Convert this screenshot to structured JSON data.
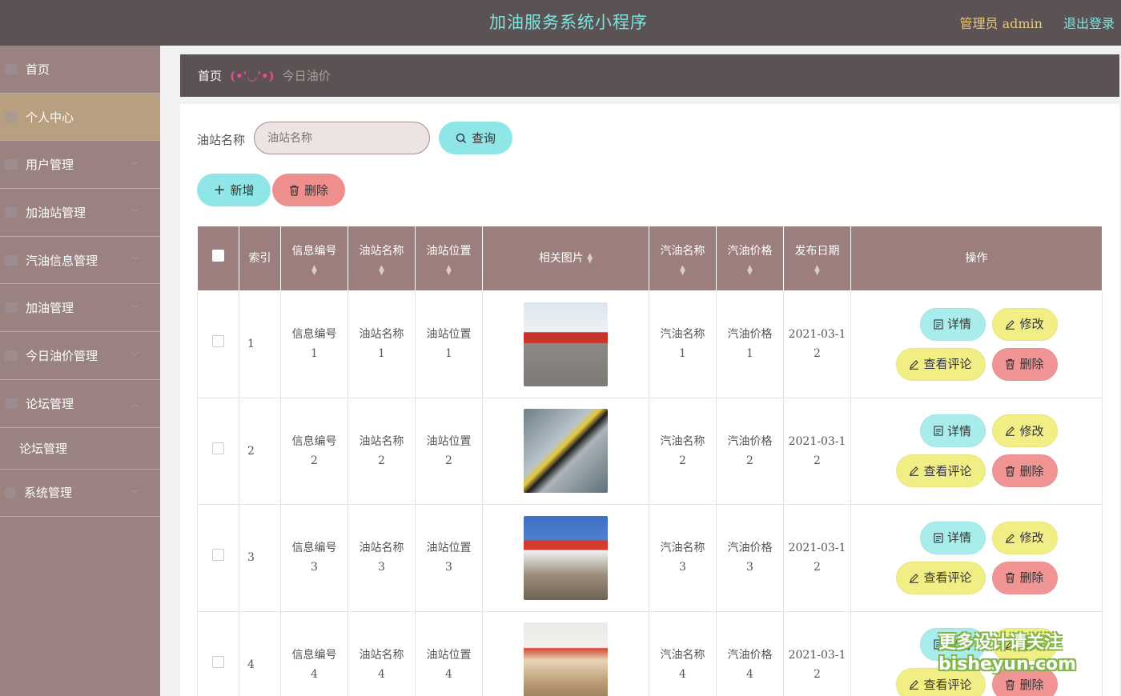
{
  "header": {
    "title": "加油服务系统小程序",
    "user": "管理员 admin",
    "logout": "退出登录"
  },
  "sidebar": {
    "items": [
      {
        "label": "首页",
        "icon": "home-icon"
      },
      {
        "label": "个人中心",
        "icon": "user-icon",
        "active": true
      },
      {
        "label": "用户管理",
        "icon": "menu-icon",
        "expandable": true
      },
      {
        "label": "加油站管理",
        "icon": "menu-icon",
        "expandable": true
      },
      {
        "label": "汽油信息管理",
        "icon": "menu-icon",
        "expandable": true
      },
      {
        "label": "加油管理",
        "icon": "menu-icon",
        "expandable": true
      },
      {
        "label": "今日油价管理",
        "icon": "menu-icon",
        "expandable": true
      },
      {
        "label": "论坛管理",
        "icon": "menu-icon",
        "expandable": true,
        "expanded": true
      },
      {
        "label": "论坛管理",
        "sub": true
      },
      {
        "label": "系统管理",
        "icon": "settings-icon",
        "expandable": true
      }
    ]
  },
  "breadcrumb": {
    "home": "首页",
    "face": "(•'◡'•)",
    "current": "今日油价"
  },
  "search": {
    "label": "油站名称",
    "placeholder": "油站名称",
    "query_button": "查询"
  },
  "toolbar": {
    "add_button": "新增",
    "delete_button": "删除"
  },
  "table": {
    "columns": [
      "索引",
      "信息编号",
      "油站名称",
      "油站位置",
      "相关图片",
      "汽油名称",
      "汽油价格",
      "发布日期",
      "操作"
    ],
    "rows": [
      {
        "index": "1",
        "info_no": [
          "信息编号",
          "1"
        ],
        "station": [
          "油站名称",
          "1"
        ],
        "location": [
          "油站位置",
          "1"
        ],
        "gas_name": [
          "汽油名称",
          "1"
        ],
        "price": [
          "汽油价格",
          "1"
        ],
        "date": [
          "2021-03-1",
          "2"
        ]
      },
      {
        "index": "2",
        "info_no": [
          "信息编号",
          "2"
        ],
        "station": [
          "油站名称",
          "2"
        ],
        "location": [
          "油站位置",
          "2"
        ],
        "gas_name": [
          "汽油名称",
          "2"
        ],
        "price": [
          "汽油价格",
          "2"
        ],
        "date": [
          "2021-03-1",
          "2"
        ]
      },
      {
        "index": "3",
        "info_no": [
          "信息编号",
          "3"
        ],
        "station": [
          "油站名称",
          "3"
        ],
        "location": [
          "油站位置",
          "3"
        ],
        "gas_name": [
          "汽油名称",
          "3"
        ],
        "price": [
          "汽油价格",
          "3"
        ],
        "date": [
          "2021-03-1",
          "2"
        ]
      },
      {
        "index": "4",
        "info_no": [
          "信息编号",
          "4"
        ],
        "station": [
          "油站名称",
          "4"
        ],
        "location": [
          "油站位置",
          "4"
        ],
        "gas_name": [
          "汽油名称",
          "4"
        ],
        "price": [
          "汽油价格",
          "4"
        ],
        "date": [
          "2021-03-1",
          "2"
        ]
      }
    ],
    "actions": {
      "detail": "详情",
      "edit": "修改",
      "comments": "查看评论",
      "delete": "删除"
    }
  },
  "watermark": {
    "line1": "更多设计请关注",
    "line2": "bisheyun.com"
  },
  "colors": {
    "header_bg": "#5b5253",
    "sidebar_bg": "#9a8280",
    "accent_cyan": "#8fe6e6",
    "accent_yellow": "#f1ee85",
    "accent_red": "#ef8f8d"
  }
}
